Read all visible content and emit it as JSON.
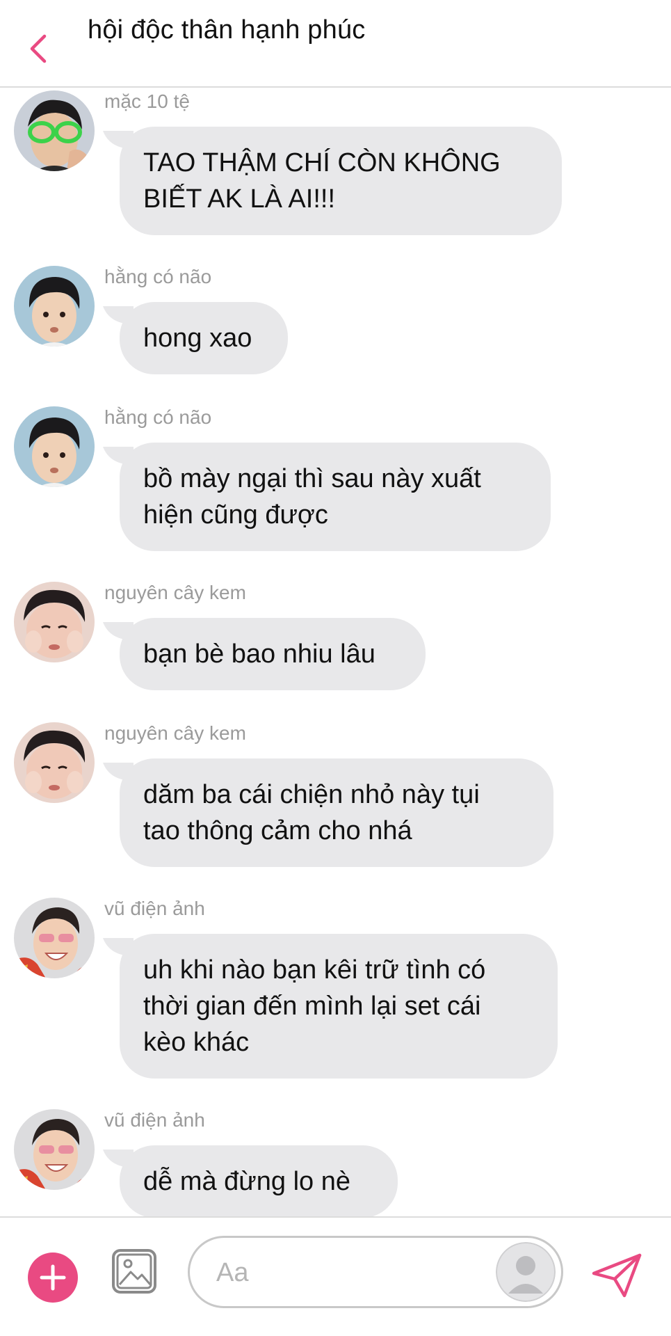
{
  "header": {
    "title": "hội độc thân hạnh phúc"
  },
  "messages": [
    {
      "sender": "mặc 10 tệ",
      "lines": [
        "TAO THẬM CHÍ CÒN KHÔNG",
        "BIẾT AK LÀ AI!!!"
      ]
    },
    {
      "sender": "hằng có não",
      "lines": [
        "hong xao"
      ]
    },
    {
      "sender": "hằng có não",
      "lines": [
        "bồ mày ngại thì sau này xuất",
        "hiện cũng được"
      ]
    },
    {
      "sender": "nguyên cây kem",
      "lines": [
        "bạn bè bao nhiu lâu"
      ]
    },
    {
      "sender": "nguyên cây kem",
      "lines": [
        "dăm ba cái chiện nhỏ này tụi",
        "tao thông cảm cho nhá"
      ]
    },
    {
      "sender": "vũ điện ảnh",
      "lines": [
        "uh khi nào bạn kêi trữ tình có",
        "thời gian đến mình lại set cái",
        "kèo khác"
      ]
    },
    {
      "sender": "vũ điện ảnh",
      "lines": [
        "dễ mà đừng lo nè"
      ]
    }
  ],
  "composer": {
    "placeholder": "Aa"
  },
  "colors": {
    "accent": "#e94a82",
    "bubble": "#e8e8ea",
    "sender_text": "#9a9a9a"
  },
  "icons": {
    "back": "chevron-left-icon",
    "add": "plus-icon",
    "image": "image-icon",
    "sticker": "profile-icon",
    "send": "send-icon"
  }
}
